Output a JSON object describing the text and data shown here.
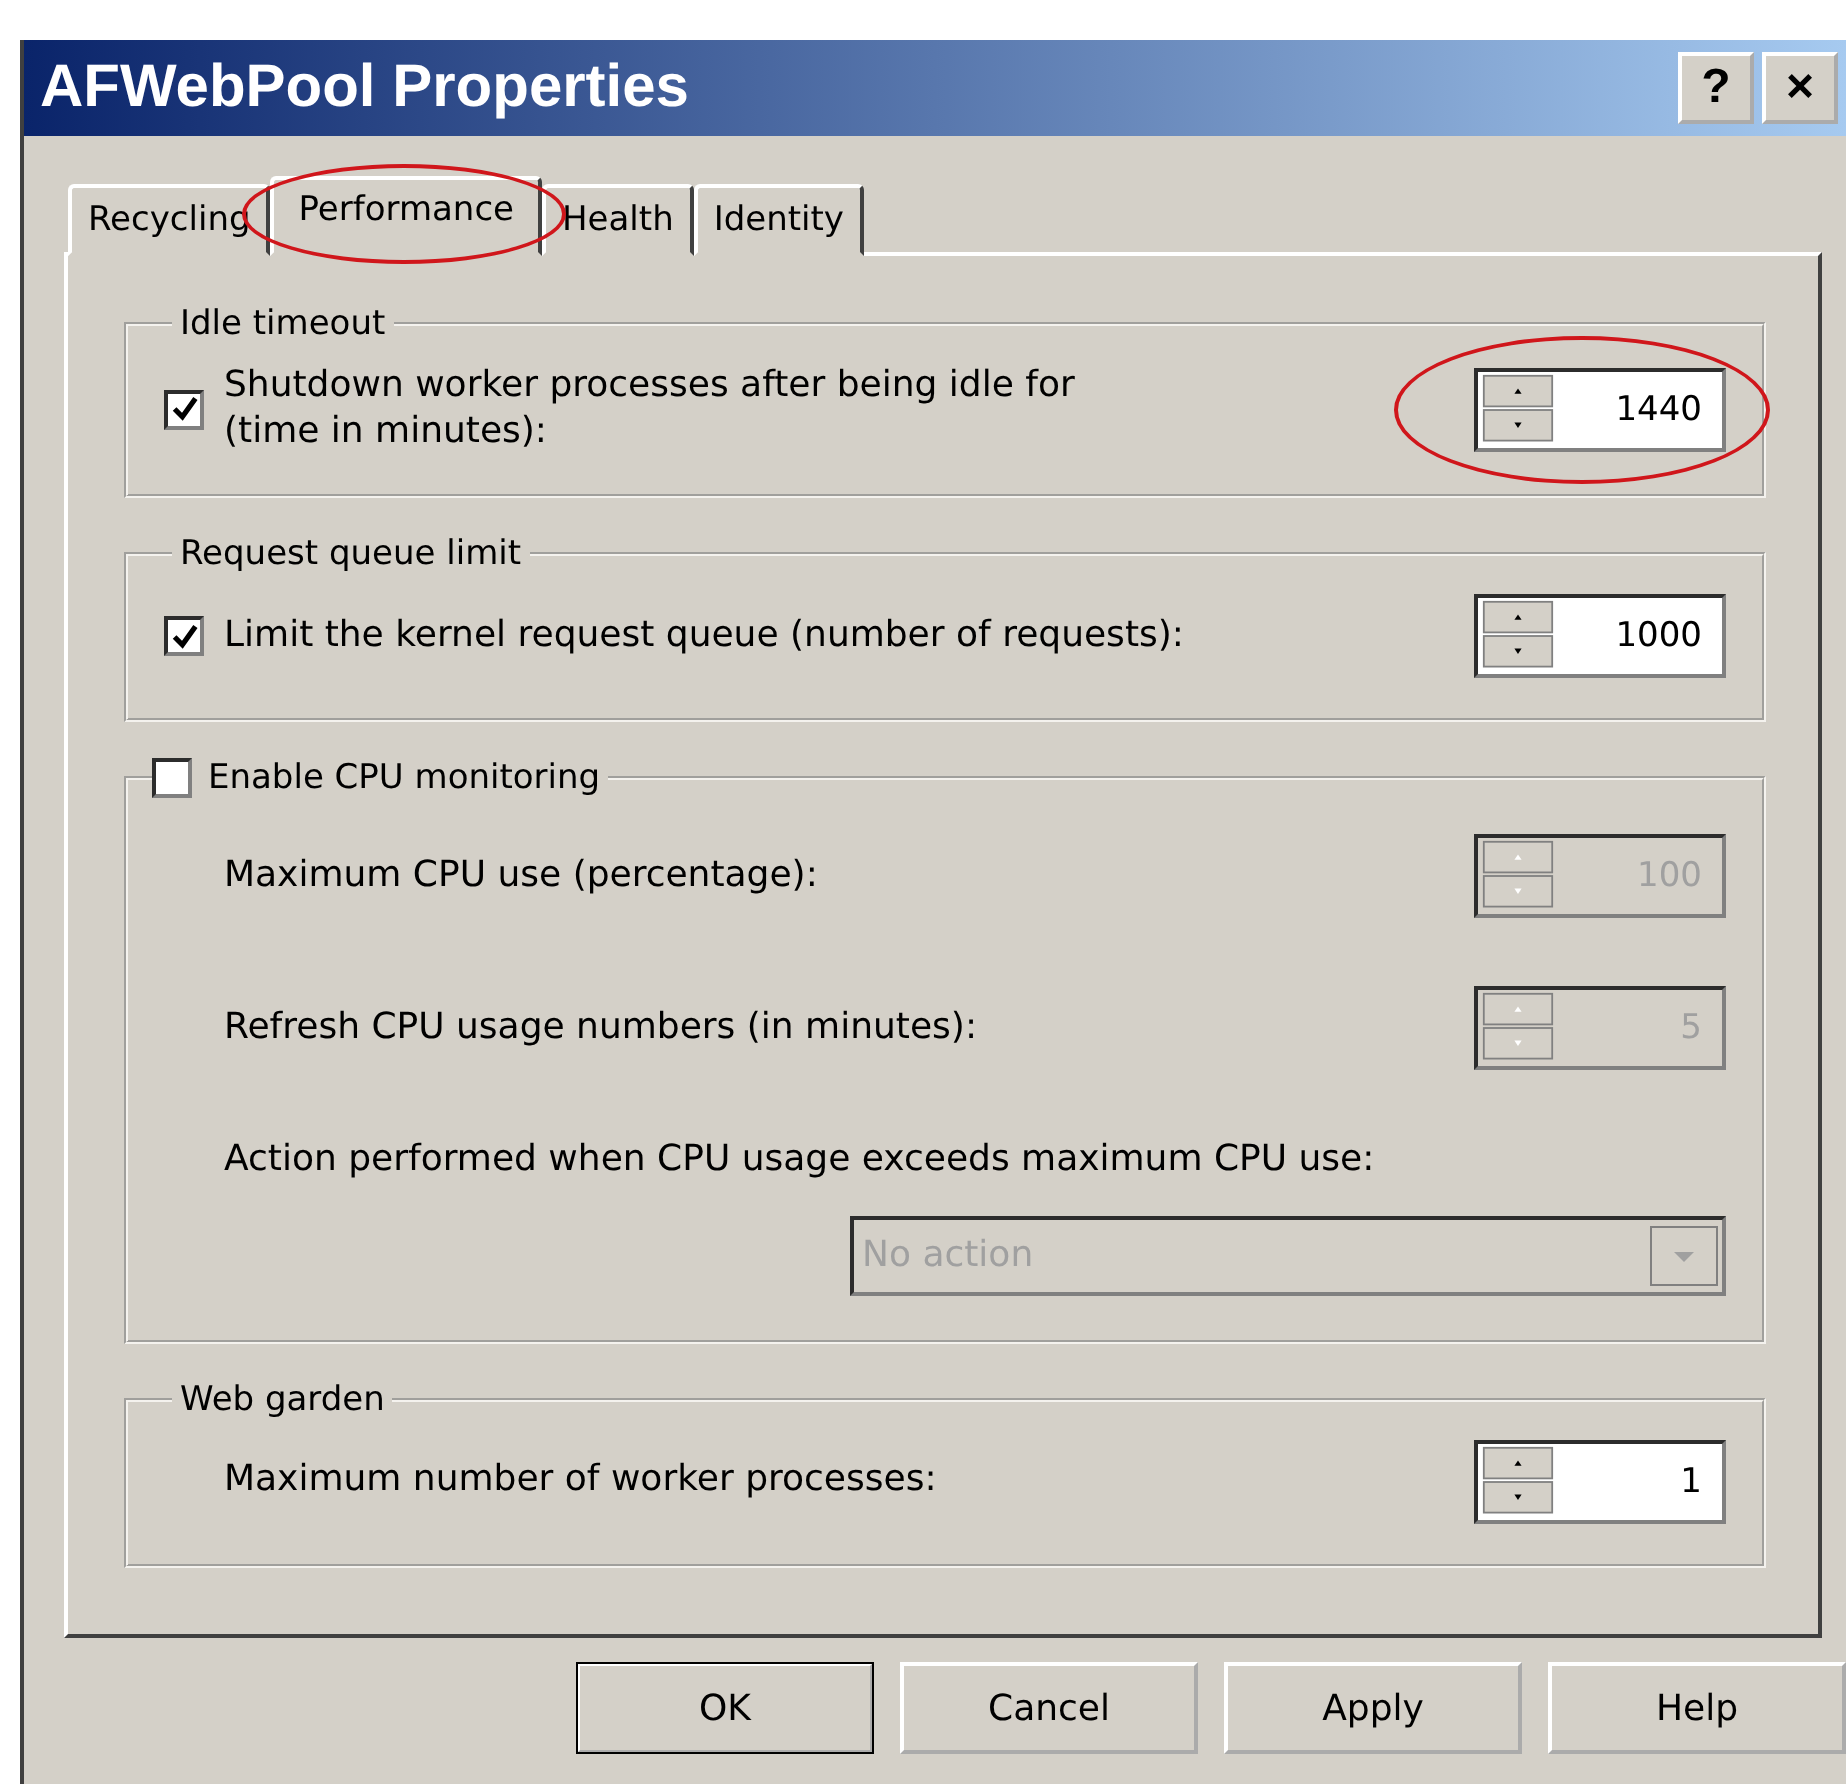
{
  "window": {
    "title": "AFWebPool Properties",
    "title_buttons": [
      "?",
      "×"
    ]
  },
  "tabs": [
    {
      "label": "Recycling",
      "selected": false,
      "highlighted": false
    },
    {
      "label": "Performance",
      "selected": true,
      "highlighted": true
    },
    {
      "label": "Health",
      "selected": false,
      "highlighted": false
    },
    {
      "label": "Identity",
      "selected": false,
      "highlighted": false
    }
  ],
  "groups": [
    {
      "title": "Idle timeout",
      "rows": [
        {
          "kind": "check_spin",
          "checked": true,
          "label": "Shutdown worker processes after being idle for",
          "label_2": "(time in minutes):",
          "value": "1440",
          "disabled": false,
          "highlighted": true
        }
      ]
    },
    {
      "title": "Request queue limit",
      "rows": [
        {
          "kind": "check_spin",
          "checked": true,
          "label": "Limit the kernel request queue (number of requests):",
          "value": "1000",
          "disabled": false,
          "highlighted": false
        }
      ]
    },
    {
      "title": "Enable CPU monitoring",
      "title_checkbox": {
        "checked": false
      },
      "rows": [
        {
          "kind": "spin",
          "label": "Maximum CPU use (percentage):",
          "value": "100",
          "disabled": true,
          "highlighted": false
        },
        {
          "kind": "spin",
          "label": "Refresh CPU usage numbers (in minutes):",
          "value": "5",
          "disabled": true,
          "highlighted": false
        },
        {
          "kind": "text",
          "label": "Action performed when CPU usage exceeds maximum CPU use:"
        },
        {
          "kind": "dropdown",
          "value": "No action",
          "disabled": true
        }
      ]
    },
    {
      "title": "Web garden",
      "rows": [
        {
          "kind": "spin",
          "label": "Maximum number of worker processes:",
          "value": "1",
          "disabled": false,
          "highlighted": false
        }
      ]
    }
  ],
  "buttons": [
    {
      "label": "OK",
      "default": true
    },
    {
      "label": "Cancel",
      "default": false
    },
    {
      "label": "Apply",
      "default": false
    },
    {
      "label": "Help",
      "default": false
    }
  ]
}
